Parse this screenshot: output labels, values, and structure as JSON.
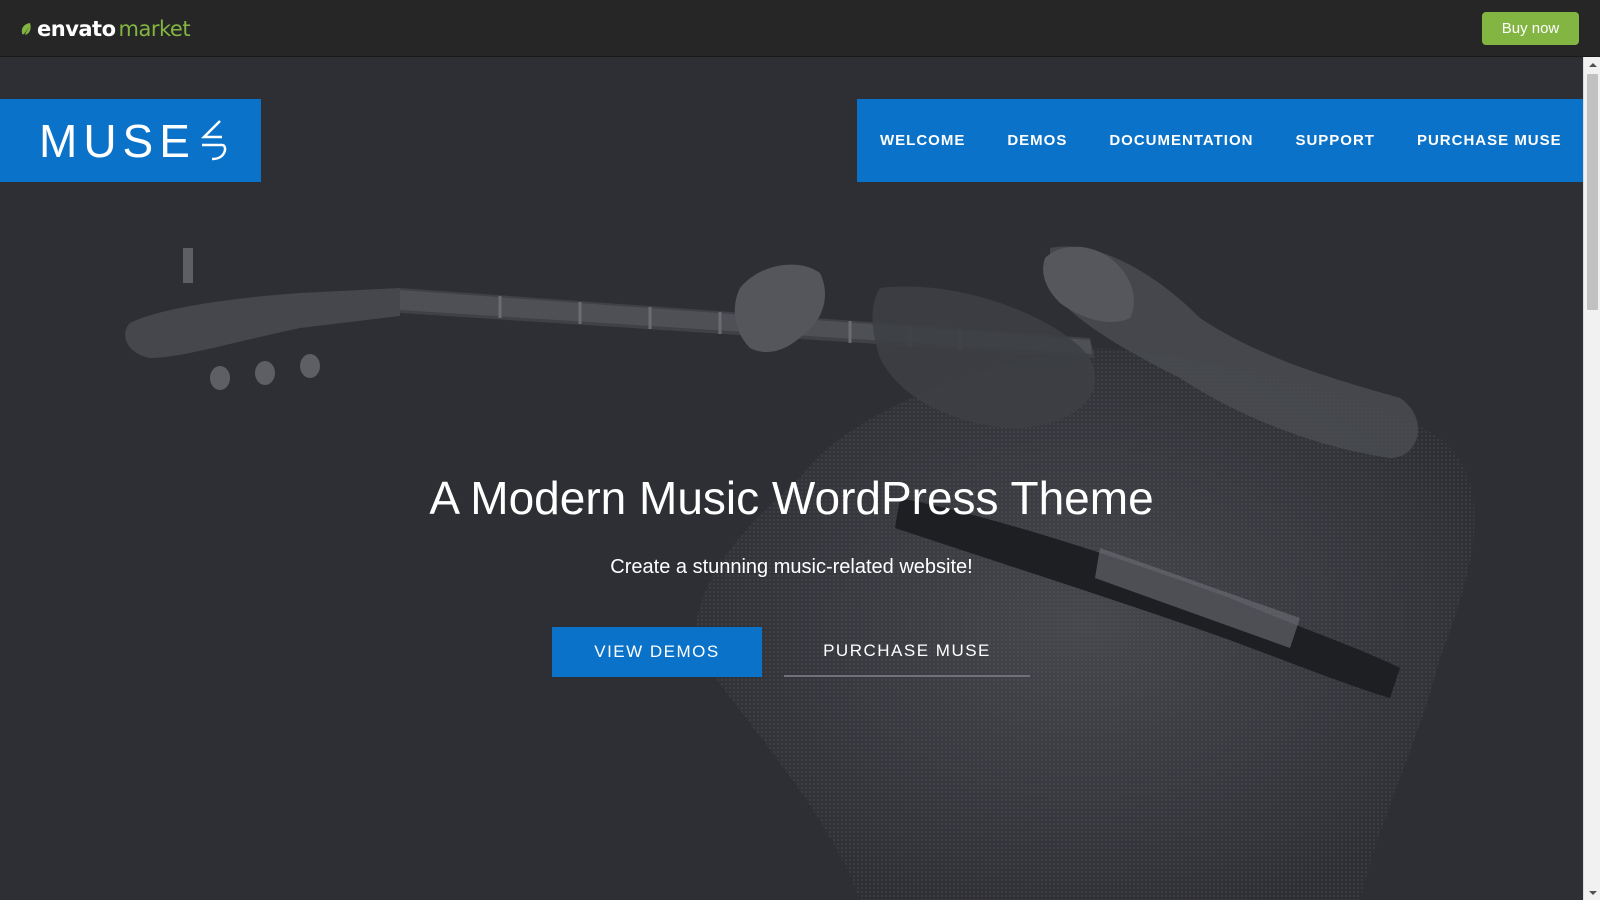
{
  "envato_bar": {
    "logo_word_1": "envato",
    "logo_word_2": "market",
    "buy_now_label": "Buy now"
  },
  "brand": {
    "logo_text": "MUSE"
  },
  "nav": {
    "items": [
      {
        "label": "WELCOME"
      },
      {
        "label": "DEMOS"
      },
      {
        "label": "DOCUMENTATION"
      },
      {
        "label": "SUPPORT"
      },
      {
        "label": "PURCHASE MUSE"
      }
    ]
  },
  "hero": {
    "title": "A Modern Music WordPress Theme",
    "subtitle": "Create a stunning music-related website!",
    "primary_button": "VIEW DEMOS",
    "secondary_button": "PURCHASE MUSE"
  },
  "colors": {
    "envato_green": "#82b541",
    "brand_blue": "#0b72c9",
    "hero_bg": "#2e2f35",
    "topbar_bg": "#262626"
  },
  "icons": {
    "logo_leaf": "leaf-icon",
    "brand_mark": "muse-mark-icon",
    "scroll_up": "chevron-up-icon",
    "scroll_down": "chevron-down-icon"
  }
}
